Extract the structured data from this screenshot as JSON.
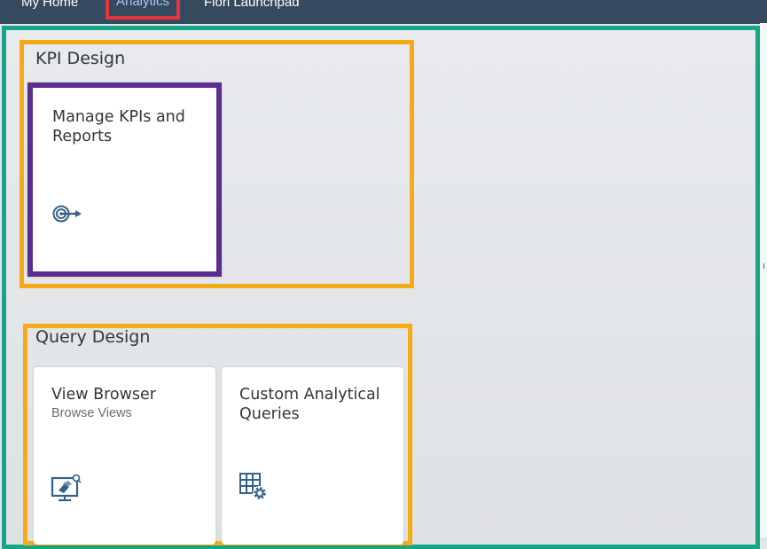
{
  "nav": {
    "items": [
      {
        "label": "My Home"
      },
      {
        "label": "Analytics",
        "active": true
      },
      {
        "label": "Fiori Launchpad"
      }
    ]
  },
  "groups": [
    {
      "title": "KPI Design",
      "tiles": [
        {
          "title": "Manage KPIs and Reports",
          "subtitle": "",
          "icon": "target-icon"
        }
      ]
    },
    {
      "title": "Query Design",
      "tiles": [
        {
          "title": "View Browser",
          "subtitle": "Browse Views",
          "icon": "view-browser-icon"
        },
        {
          "title": "Custom Analytical Queries",
          "subtitle": "",
          "icon": "table-settings-icon"
        }
      ]
    }
  ],
  "colors": {
    "shell": "#354a5f",
    "active_tab_highlight": "#e8343c",
    "annotation_main": "#16a587",
    "annotation_group": "#f5ab16",
    "annotation_tile": "#5b2d8e",
    "icon": "#346187"
  }
}
